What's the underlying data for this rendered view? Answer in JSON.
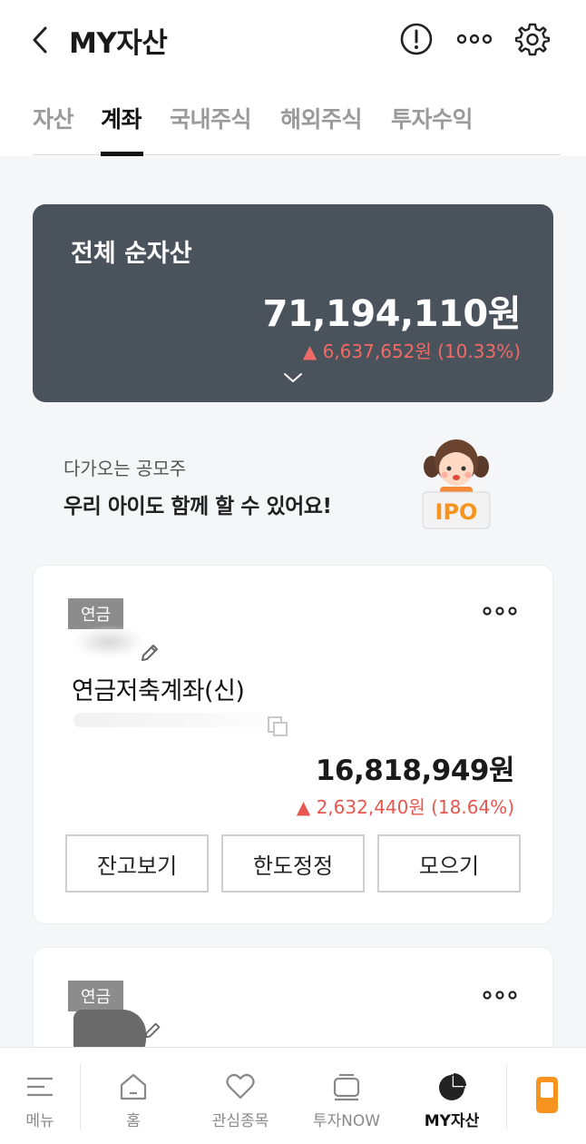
{
  "header": {
    "title": "MY자산",
    "tabs": [
      "자산",
      "계좌",
      "국내주식",
      "해외주식",
      "투자수익"
    ],
    "active_tab": "계좌"
  },
  "total": {
    "label": "전체 순자산",
    "value": "71,194,110원",
    "change": "▲ 6,637,652원 (10.33%)"
  },
  "promo": {
    "subtitle": "다가오는 공모주",
    "headline": "우리 아이도 함께 할 수 있어요!",
    "art_text": "IPO"
  },
  "accounts": [
    {
      "badge": "연금",
      "name": "연금저축계좌(신)",
      "value": "16,818,949원",
      "change": "▲ 2,632,440원 (18.64%)",
      "buttons": [
        "잔고보기",
        "한도정정",
        "모으기"
      ]
    },
    {
      "badge": "연금"
    }
  ],
  "bottom_nav": [
    {
      "label": "메뉴",
      "icon": "menu-icon"
    },
    {
      "label": "홈",
      "icon": "home-icon"
    },
    {
      "label": "관심종목",
      "icon": "heart-icon"
    },
    {
      "label": "투자NOW",
      "icon": "tv-icon"
    },
    {
      "label": "MY자산",
      "icon": "pie-chart-icon",
      "active": true
    },
    {
      "label": "",
      "icon": "phone-icon"
    }
  ],
  "colors": {
    "card_dark": "#4a525b",
    "up_red": "#e5574f",
    "accent_orange": "#f7931e"
  }
}
